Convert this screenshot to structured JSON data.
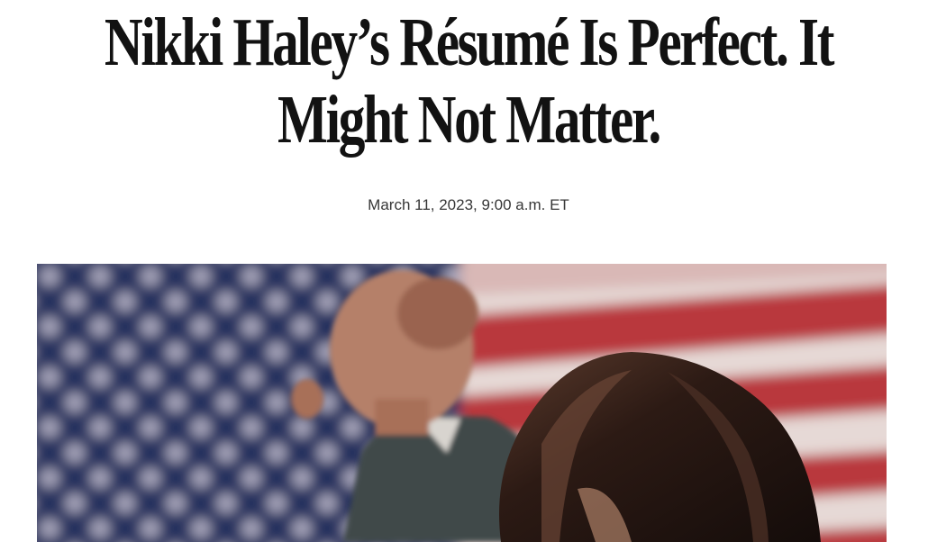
{
  "article": {
    "headline_line1": "Nikki Haley’s Résumé Is Perfect. It",
    "headline_line2": "Might Not Matter.",
    "dateline": "March 11, 2023, 9:00 a.m. ET"
  },
  "hero_image": {
    "description_icon": "photo-flag-podium",
    "colors": {
      "flag_blue": "#28305e",
      "flag_red": "#b9383d",
      "flag_white": "#e6d9d6",
      "suit": "#3f4a48",
      "hair": "#2a1a14",
      "skin": "#b9826a"
    }
  }
}
